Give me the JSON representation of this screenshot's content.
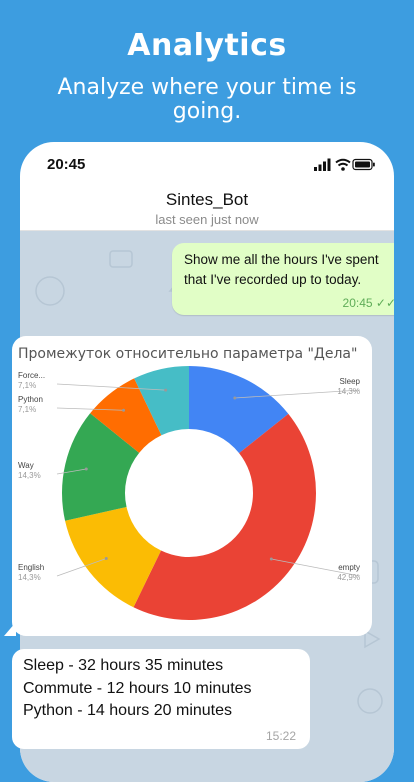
{
  "promo": {
    "title": "Analytics",
    "subtitle": "Analyze where your time is going."
  },
  "status_bar": {
    "time": "20:45"
  },
  "chat_header": {
    "name": "Sintes_Bot",
    "status": "last seen just now"
  },
  "messages": {
    "outgoing": {
      "text": "Show me all the hours I've spent that I've recorded up to today.",
      "time": "20:45"
    },
    "incoming": {
      "lines": [
        "Sleep - 32 hours 35 minutes",
        "Commute - 12 hours 10 minutes",
        "Python - 14 hours 20 minutes"
      ],
      "time": "15:22"
    }
  },
  "colors": {
    "background": "#3d9de0",
    "outgoing_bubble": "#e1fec6",
    "chat_background": "#c8d6e2"
  },
  "chart_data": {
    "type": "pie",
    "title": "Промежуток относительно параметра \"Дела\"",
    "slices": [
      {
        "label": "Sleep",
        "value": 14.3,
        "value_label": "14,3%",
        "color": "#4285f4"
      },
      {
        "label": "empty",
        "value": 42.9,
        "value_label": "42,9%",
        "color": "#ea4335"
      },
      {
        "label": "English",
        "value": 14.3,
        "value_label": "14,3%",
        "color": "#fbbc04"
      },
      {
        "label": "Way",
        "value": 14.3,
        "value_label": "14,3%",
        "color": "#34a853"
      },
      {
        "label": "Python",
        "value": 7.1,
        "value_label": "7,1%",
        "color": "#ff6d01"
      },
      {
        "label": "Force...",
        "value": 7.1,
        "value_label": "7,1%",
        "color": "#46bdc6"
      }
    ],
    "donut": true,
    "legend": "labels beside slices"
  }
}
